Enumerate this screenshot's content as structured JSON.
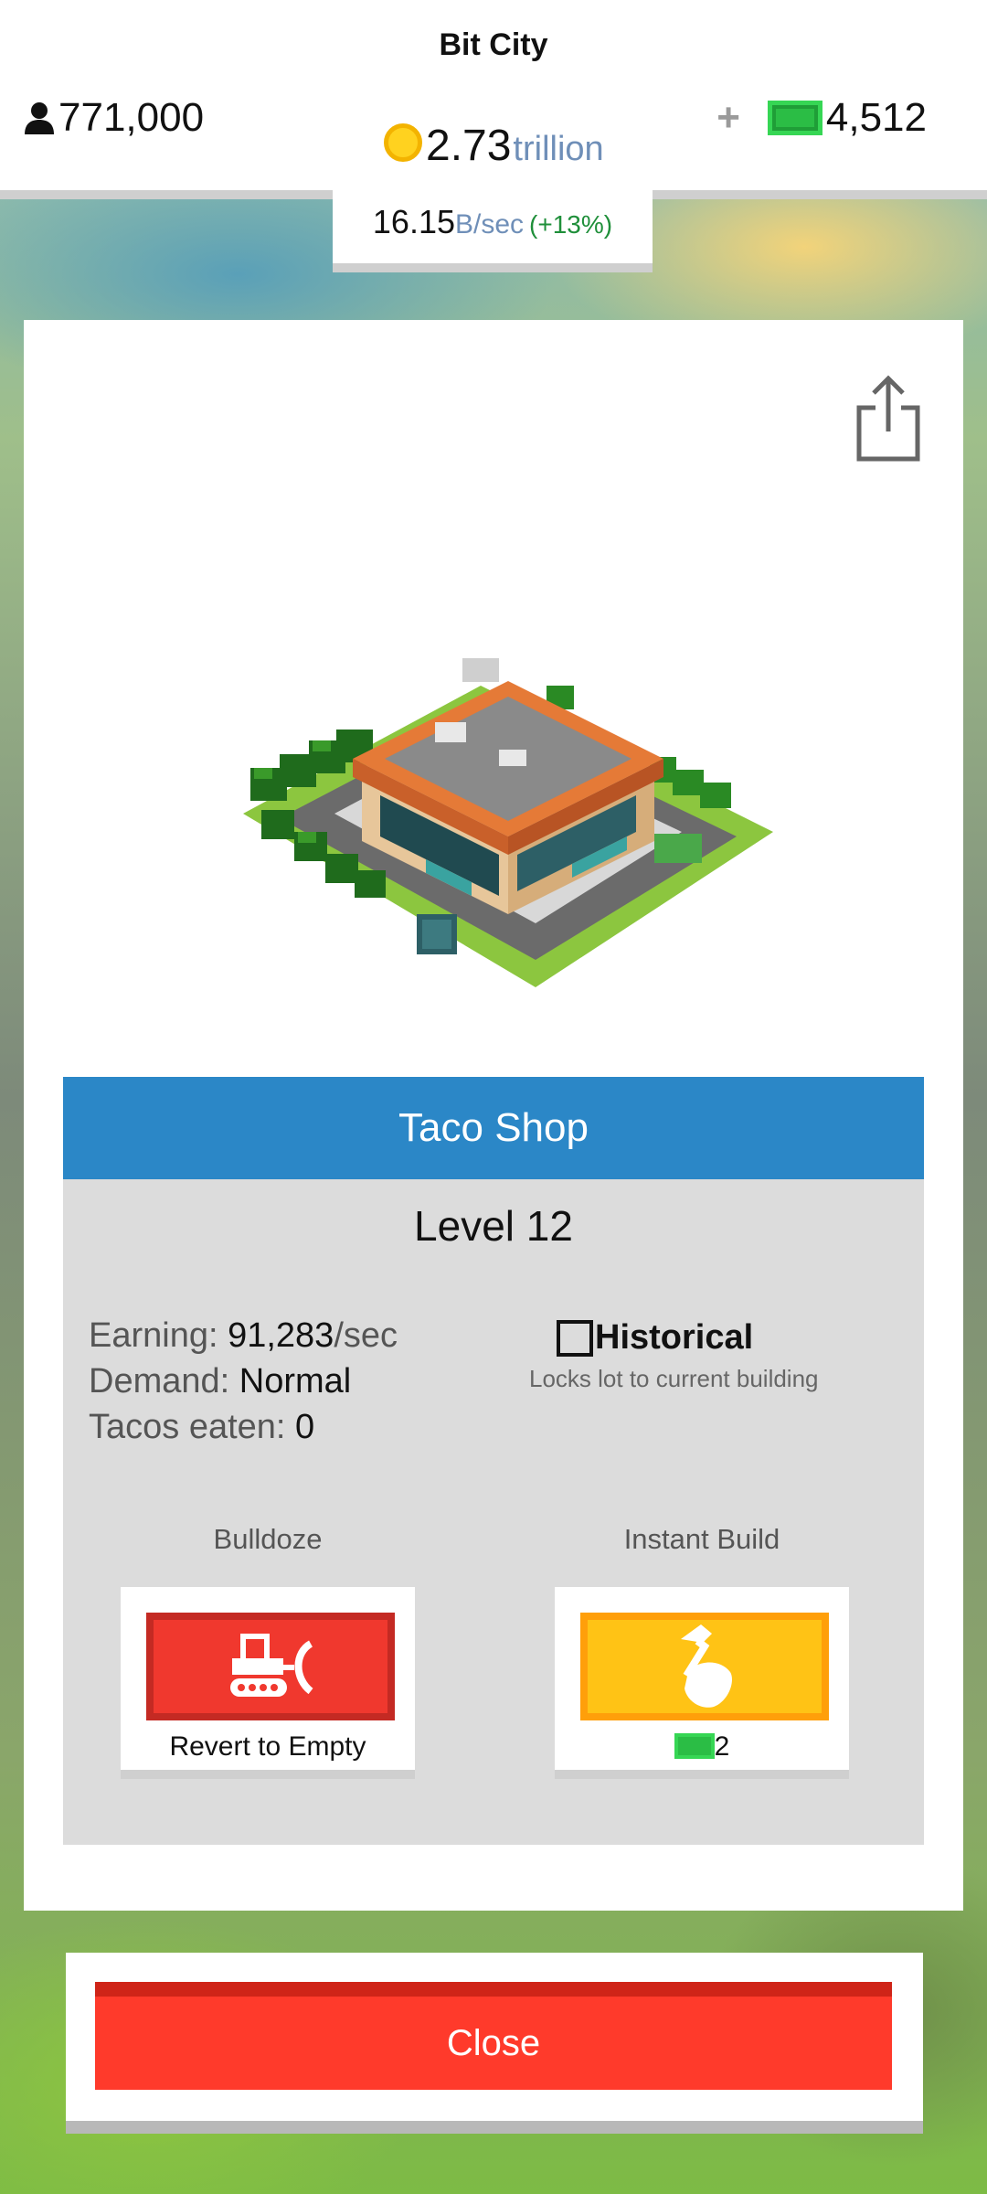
{
  "header": {
    "app_title": "Bit City",
    "population": "771,000",
    "gold_value": "2.73",
    "gold_unit": "trillion",
    "rate_value": "16.15",
    "rate_unit": "B/sec",
    "rate_change": "(+13%)",
    "cash_value": "4,512",
    "add_cash_label": "+"
  },
  "building": {
    "name": "Taco Shop",
    "level": "Level 12",
    "stats": [
      {
        "key": "Earning: ",
        "value": "91,283",
        "suffix": "/sec"
      },
      {
        "key": "Demand: ",
        "value": "Normal",
        "suffix": ""
      },
      {
        "key": "Tacos eaten: ",
        "value": "0",
        "suffix": ""
      }
    ],
    "historical": {
      "label": "Historical",
      "description": "Locks lot to current building",
      "checked": false
    }
  },
  "actions": {
    "bulldoze": {
      "title": "Bulldoze",
      "caption": "Revert to Empty",
      "icon": "bulldozer-icon"
    },
    "instant_build": {
      "title": "Instant Build",
      "cost": "2",
      "icon": "hammer-icon"
    }
  },
  "close_label": "Close",
  "colors": {
    "banner": "#2b87c7",
    "bulldoze": "#f0382e",
    "instant_build": "#ffc315",
    "close": "#ff3a2b",
    "cash": "#2bbd45",
    "coin": "#ffd21f"
  }
}
